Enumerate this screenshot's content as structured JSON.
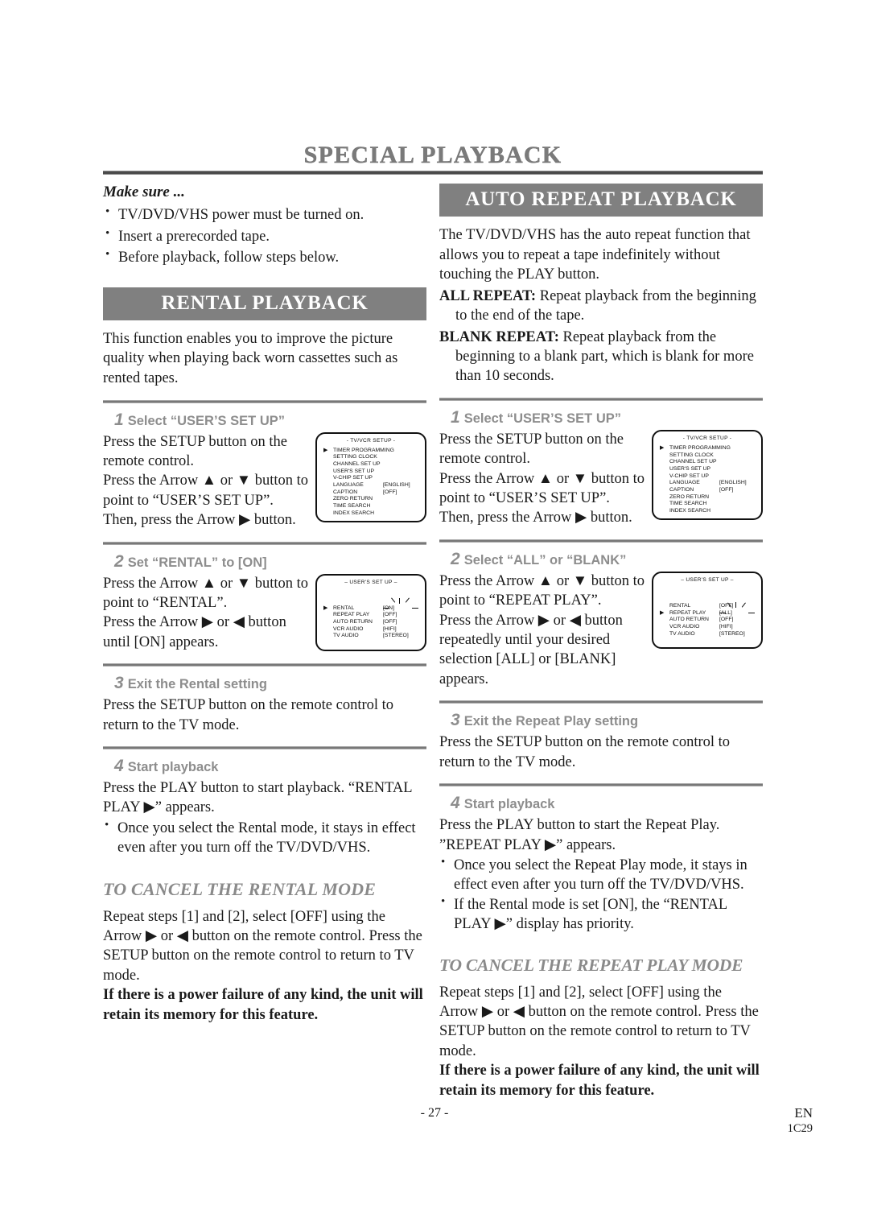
{
  "page": {
    "title": "SPECIAL PLAYBACK",
    "footer_page_number": "- 27 -",
    "footer_lang": "EN",
    "footer_code": "1C29",
    "accent_grey": "#808080",
    "heading_grey": "#8d8d8d"
  },
  "make_sure": {
    "title": "Make sure ...",
    "items": [
      "TV/DVD/VHS power must be turned on.",
      "Insert a prerecorded tape.",
      "Before playback, follow steps below."
    ]
  },
  "rental": {
    "heading": "RENTAL PLAYBACK",
    "intro": "This function enables you to improve the picture quality when playing back worn cassettes such as rented tapes.",
    "steps": [
      {
        "number": "1",
        "title": "Select “USER’S SET UP”",
        "lines": [
          "Press the SETUP button on the remote control.",
          "Press the Arrow ▲ or ▼ button to point to “USER’S SET UP”.",
          "Then, press the Arrow ▶ button."
        ]
      },
      {
        "number": "2",
        "title": "Set “RENTAL” to [ON]",
        "lines": [
          "Press the Arrow ▲ or ▼ button to point to “RENTAL”.",
          "Press the Arrow ▶ or ◀ button until [ON] appears."
        ]
      },
      {
        "number": "3",
        "title": "Exit the Rental setting",
        "lines": [
          "Press the SETUP button on the remote control to return to the TV mode."
        ]
      },
      {
        "number": "4",
        "title": "Start playback",
        "lines": [
          "Press the PLAY button to start playback. “RENTAL PLAY ▶” appears."
        ],
        "bullets": [
          "Once you select the Rental mode, it stays in effect even after you turn off the TV/DVD/VHS."
        ]
      }
    ],
    "cancel": {
      "title": "TO CANCEL THE RENTAL MODE",
      "body": "Repeat steps [1] and [2], select [OFF] using the Arrow ▶ or ◀ button on the remote control. Press the SETUP button on the remote control to return to TV mode.",
      "note": "If there is a power failure of any kind, the unit will retain its memory for this feature."
    }
  },
  "auto_repeat": {
    "heading": "AUTO REPEAT PLAYBACK",
    "intro": "The TV/DVD/VHS has the auto repeat function that allows you to repeat a tape indefinitely without touching the PLAY button.",
    "definitions": [
      {
        "term": "ALL REPEAT:",
        "text": "Repeat playback from the beginning to the end of the tape."
      },
      {
        "term": "BLANK REPEAT:",
        "text": "Repeat playback from the beginning to a blank part, which is blank for more than 10 seconds."
      }
    ],
    "steps": [
      {
        "number": "1",
        "title": "Select “USER’S SET UP”",
        "lines": [
          "Press the SETUP button on the remote control.",
          "Press the Arrow ▲ or ▼ button to point to “USER’S SET UP”.",
          "Then, press the Arrow ▶ button."
        ]
      },
      {
        "number": "2",
        "title": "Select “ALL” or “BLANK”",
        "lines": [
          "Press the Arrow ▲ or ▼ button to point to “REPEAT PLAY”.",
          "Press the Arrow ▶ or ◀ button repeatedly until your desired selection [ALL] or [BLANK] appears."
        ]
      },
      {
        "number": "3",
        "title": "Exit the Repeat Play setting",
        "lines": [
          "Press the SETUP button on the remote control to return to the TV mode."
        ]
      },
      {
        "number": "4",
        "title": "Start playback",
        "lines": [
          "Press the PLAY button to start the Repeat Play. ”REPEAT PLAY ▶” appears."
        ],
        "bullets": [
          "Once you select the Repeat Play mode, it stays in effect even after you turn off the TV/DVD/VHS.",
          "If the Rental mode is set [ON], the “RENTAL PLAY ▶” display has priority."
        ]
      }
    ],
    "cancel": {
      "title": "TO CANCEL THE REPEAT PLAY MODE",
      "body": "Repeat steps [1] and [2], select [OFF] using the Arrow ▶ or ◀ button on the remote control. Press the SETUP button on the remote control to return to TV mode.",
      "note": "If there is a power failure of any kind, the unit will retain its memory for this feature."
    }
  },
  "osd": {
    "tv_vcr_setup": {
      "title": "- TV/VCR SETUP -",
      "cursor_index": 3,
      "rows": [
        {
          "label": "TIMER PROGRAMMING",
          "value": ""
        },
        {
          "label": "SETTING CLOCK",
          "value": ""
        },
        {
          "label": "CHANNEL SET UP",
          "value": ""
        },
        {
          "label": "USER'S SET UP",
          "value": ""
        },
        {
          "label": "V-CHIP SET UP",
          "value": ""
        },
        {
          "label": "LANGUAGE",
          "value": "[ENGLISH]"
        },
        {
          "label": "CAPTION",
          "value": "[OFF]"
        },
        {
          "label": "ZERO RETURN",
          "value": ""
        },
        {
          "label": "TIME SEARCH",
          "value": ""
        },
        {
          "label": "INDEX SEARCH",
          "value": ""
        }
      ]
    },
    "users_setup_rental": {
      "title": "– USER'S SET UP –",
      "cursor_index": 0,
      "highlight_index": 0,
      "rows": [
        {
          "label": "RENTAL",
          "value": "[ON]"
        },
        {
          "label": "REPEAT PLAY",
          "value": "[OFF]"
        },
        {
          "label": "AUTO RETURN",
          "value": "[OFF]"
        },
        {
          "label": "VCR AUDIO",
          "value": "[HIFI]"
        },
        {
          "label": "TV AUDIO",
          "value": "[STEREO]"
        }
      ]
    },
    "users_setup_repeat": {
      "title": "– USER'S SET UP –",
      "cursor_index": 1,
      "highlight_index": 1,
      "rows": [
        {
          "label": "RENTAL",
          "value": "[OFF]"
        },
        {
          "label": "REPEAT PLAY",
          "value": "[ALL]"
        },
        {
          "label": "AUTO RETURN",
          "value": "[OFF]"
        },
        {
          "label": "VCR AUDIO",
          "value": "[HIFI]"
        },
        {
          "label": "TV AUDIO",
          "value": "[STEREO]"
        }
      ]
    }
  }
}
